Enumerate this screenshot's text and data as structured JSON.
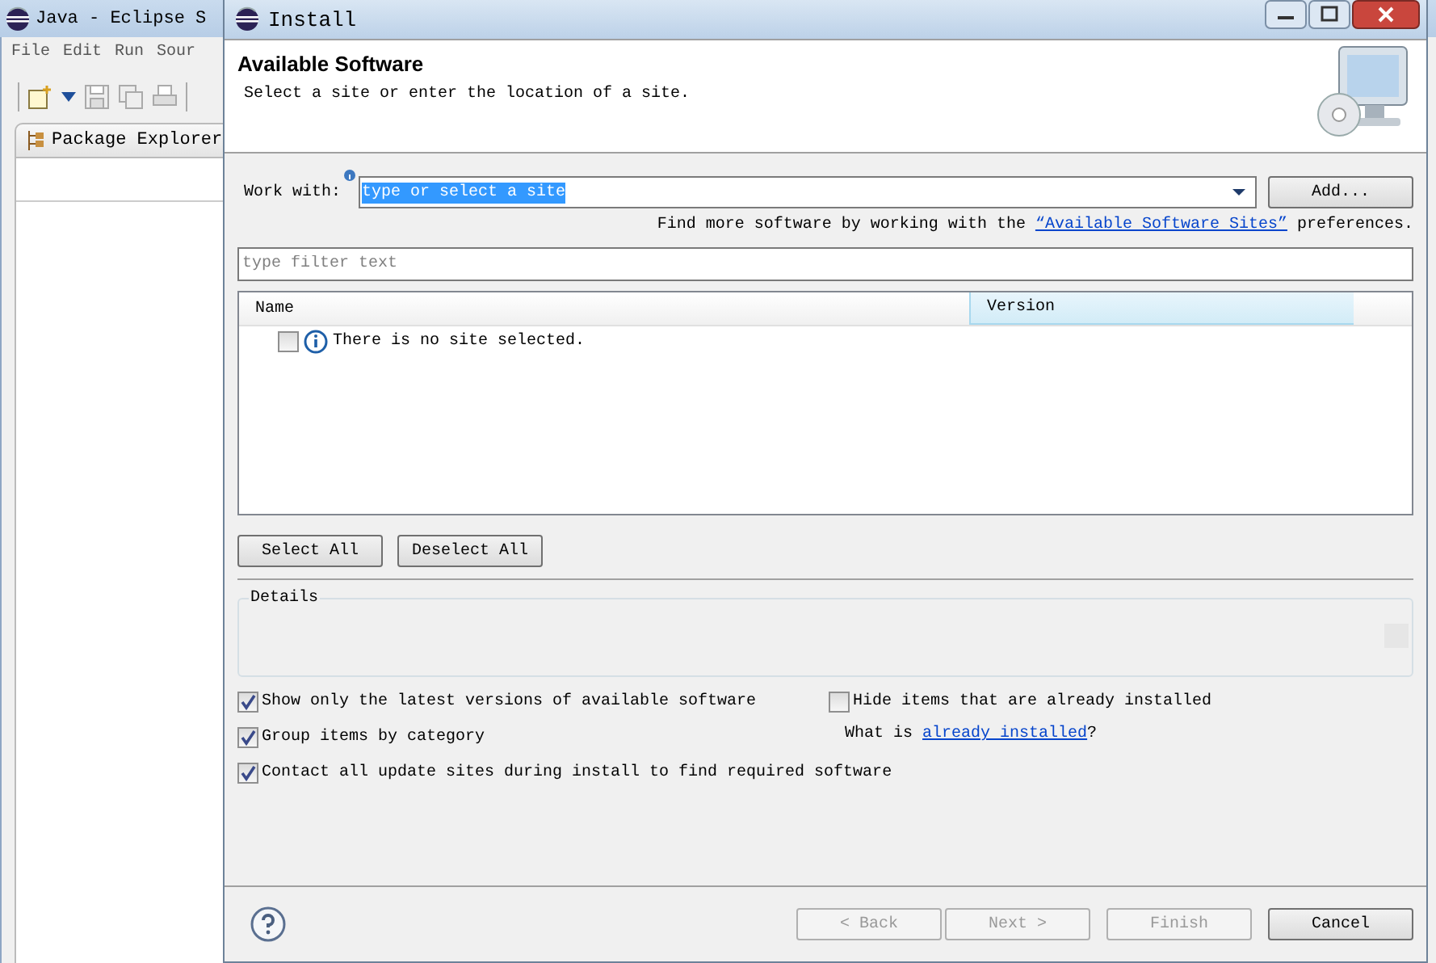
{
  "background_window": {
    "title": "Java - Eclipse S",
    "menu": [
      "File",
      "Edit",
      "Run",
      "Sour"
    ],
    "view_tab": "Package Explorer"
  },
  "dialog": {
    "title": "Install",
    "heading": "Available Software",
    "description": "Select a site or enter the location of a site."
  },
  "work_with": {
    "label": "Work with:",
    "value": "type or select a site",
    "add_button": "Add..."
  },
  "find_more": {
    "before": "Find more software by working with the ",
    "link": "“Available Software Sites”",
    "after": " preferences."
  },
  "filter": {
    "placeholder": "type filter text"
  },
  "table": {
    "columns": [
      "Name",
      "Version"
    ],
    "rows": [
      {
        "checked": false,
        "text": "There is no site selected."
      }
    ]
  },
  "selection_buttons": [
    "Select All",
    "Deselect All"
  ],
  "details": {
    "label": "Details"
  },
  "left_options": [
    {
      "label": "Show only the latest versions of available software",
      "checked": true
    },
    {
      "label": "Group items by category",
      "checked": true
    },
    {
      "label": "Contact all update sites during install to find required software",
      "checked": true
    }
  ],
  "right_options": [
    {
      "label": "Hide items that are already installed",
      "checked": false
    }
  ],
  "installed_hint": {
    "before": "What is ",
    "link": "already installed",
    "after": "?"
  },
  "footer_buttons": [
    {
      "label": "< Back",
      "disabled": true
    },
    {
      "label": "Next >",
      "disabled": true
    },
    {
      "label": "Finish",
      "disabled": true
    },
    {
      "label": "Cancel",
      "disabled": false
    }
  ]
}
